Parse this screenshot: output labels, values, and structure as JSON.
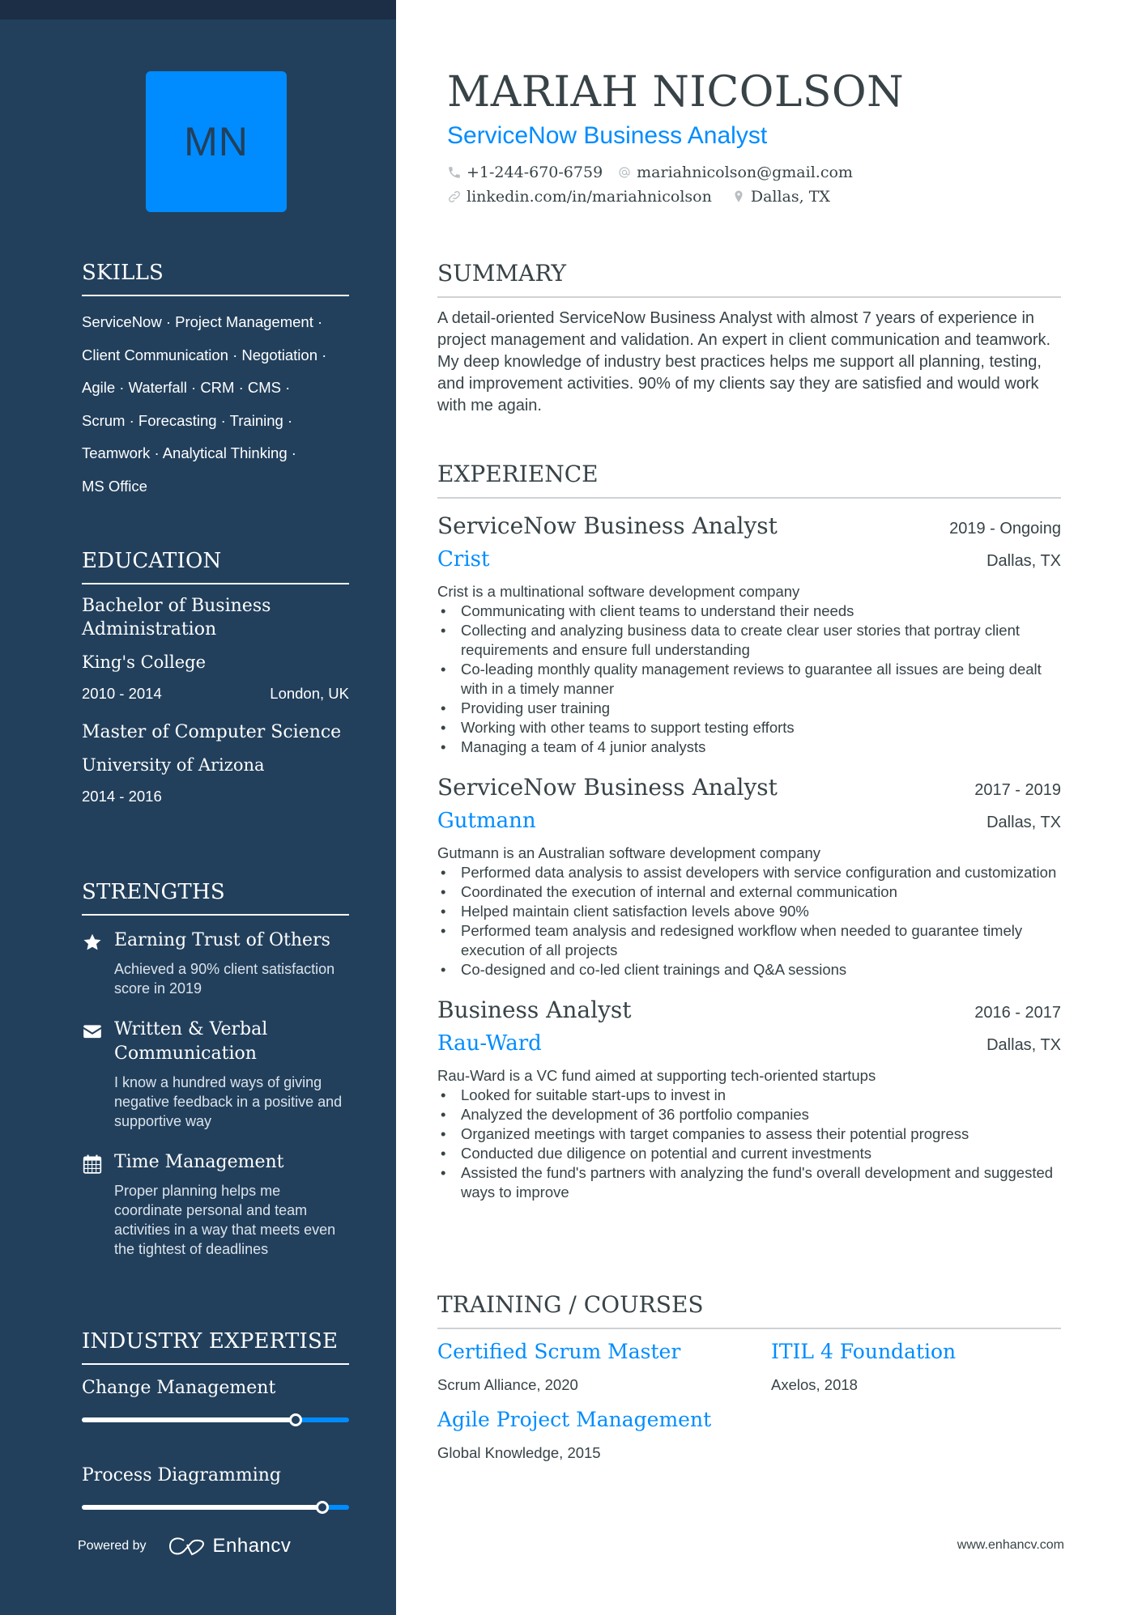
{
  "profile": {
    "initials": "MN",
    "name": "MARIAH NICOLSON",
    "title": "ServiceNow Business Analyst",
    "phone": "+1-244-670-6759",
    "email": "mariahnicolson@gmail.com",
    "linkedin": "linkedin.com/in/mariahnicolson",
    "location": "Dallas, TX"
  },
  "colors": {
    "sidebar": "#22405c",
    "accent": "#008cff",
    "text": "#384347"
  },
  "skills": {
    "heading": "SKILLS",
    "lines": [
      "ServiceNow · Project Management ·",
      "Client Communication · Negotiation ·",
      "Agile · Waterfall · CRM · CMS ·",
      "Scrum · Forecasting · Training ·",
      "Teamwork · Analytical Thinking ·",
      "MS Office"
    ]
  },
  "education": {
    "heading": "EDUCATION",
    "items": [
      {
        "degree": "Bachelor of Business Administration",
        "school": "King's College",
        "dates": "2010 - 2014",
        "location": "London, UK"
      },
      {
        "degree": "Master of Computer Science",
        "school": "University of Arizona",
        "dates": "2014 - 2016",
        "location": ""
      }
    ]
  },
  "strengths": {
    "heading": "STRENGTHS",
    "items": [
      {
        "icon": "star-icon",
        "title": "Earning Trust of Others",
        "desc": "Achieved a 90% client satisfaction score in 2019"
      },
      {
        "icon": "envelope-icon",
        "title": "Written & Verbal Communication",
        "desc": "I know a hundred ways of giving negative feedback in a positive and supportive way"
      },
      {
        "icon": "calendar-icon",
        "title": "Time Management",
        "desc": "Proper planning helps me coordinate personal and team activities in a way that meets even the tightest of deadlines"
      }
    ]
  },
  "expertise": {
    "heading": "INDUSTRY EXPERTISE",
    "items": [
      {
        "label": "Change Management",
        "level": 0.8
      },
      {
        "label": "Process Diagramming",
        "level": 0.9
      }
    ]
  },
  "footer": {
    "powered_by": "Powered by",
    "brand": "Enhancv",
    "site": "www.enhancv.com"
  },
  "summary": {
    "heading": "SUMMARY",
    "text": "A detail-oriented ServiceNow Business Analyst with almost 7 years of experience in project management and validation. An expert in client communication and teamwork. My deep knowledge of industry best practices helps me support all planning, testing, and improvement activities. 90% of my clients say they are satisfied and would work with me again."
  },
  "experience": {
    "heading": "EXPERIENCE",
    "jobs": [
      {
        "role": "ServiceNow Business Analyst",
        "dates": "2019 - Ongoing",
        "company": "Crist",
        "location": "Dallas, TX",
        "description": "Crist is a multinational software development company",
        "bullets": [
          "Communicating with client teams to understand their needs",
          "Collecting and analyzing business data to create clear user stories that portray client requirements and ensure full understanding",
          "Co-leading monthly quality management reviews to guarantee all issues are being dealt with in a timely manner",
          "Providing user training",
          "Working with other teams to support testing efforts",
          "Managing a team of 4 junior analysts"
        ]
      },
      {
        "role": "ServiceNow Business Analyst",
        "dates": "2017 - 2019",
        "company": "Gutmann",
        "location": "Dallas, TX",
        "description": "Gutmann is an Australian software development company",
        "bullets": [
          "Performed data analysis to assist developers with service configuration and customization",
          "Coordinated the execution of internal and external communication",
          "Helped maintain client satisfaction levels above 90%",
          "Performed team analysis and redesigned workflow when needed to guarantee timely execution of all projects",
          "Co-designed and co-led client trainings and Q&A sessions"
        ]
      },
      {
        "role": "Business Analyst",
        "dates": "2016 - 2017",
        "company": "Rau-Ward",
        "location": "Dallas, TX",
        "description": "Rau-Ward is a VC fund aimed at supporting tech-oriented startups",
        "bullets": [
          "Looked for suitable start-ups to invest in",
          "Analyzed the development of 36 portfolio companies",
          "Organized meetings with target companies to assess their potential progress",
          "Conducted due diligence on potential and current investments",
          "Assisted the fund's partners with analyzing the fund's overall development and suggested ways to improve"
        ]
      }
    ]
  },
  "training": {
    "heading": "TRAINING / COURSES",
    "items": [
      {
        "title": "Certified Scrum Master",
        "org": "Scrum Alliance, 2020"
      },
      {
        "title": "ITIL 4 Foundation",
        "org": "Axelos, 2018"
      },
      {
        "title": "Agile Project Management",
        "org": "Global Knowledge, 2015"
      }
    ]
  }
}
